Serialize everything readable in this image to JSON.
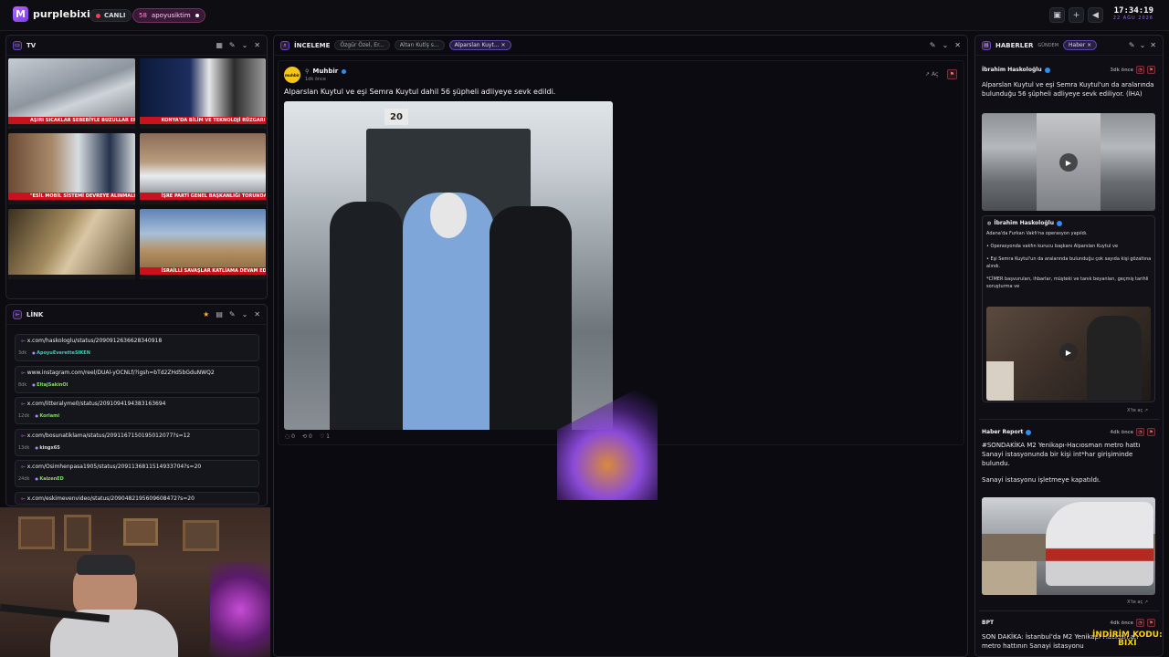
{
  "app": {
    "name": "purplebixi"
  },
  "topbar": {
    "live_label": "CANLI",
    "channel_count": "58",
    "channel_name": "apoyusiktim",
    "time": "17:34:19",
    "date": "22 AĞU 2026"
  },
  "tv_panel": {
    "title": "TV",
    "captions": [
      "AŞIRI SICAKLAR SEBEBİYLE BUZULLAR ERİYOR",
      "KONYA'DA BİLİM VE TEKNOLOJİ RÜZGARI",
      "\"ESİL MOBİL SİSTEMİ DEVREYE ALINMALI\"",
      "İŞRE PARTİ GENEL BAŞKANLIĞI TORUNDA",
      "",
      "İSRAİLLİ SAVAŞLAR KATLİAMA DEVAM EDİYOR"
    ]
  },
  "link_panel": {
    "title": "LİNK",
    "items": [
      {
        "url": "x.com/haskologlu/status/2090912636628340918",
        "age": "3dk",
        "user": "ApoyuEverettеSIKEN",
        "color": "#38d0b8"
      },
      {
        "url": "www.instagram.com/reel/DUAl-yOCNLf/?igsh=bTd2ZHd5bGduNWQ2",
        "age": "8dk",
        "user": "EltajSakinOl",
        "color": "#7ee05b"
      },
      {
        "url": "x.com/litteralyme0/status/2091094194383163694",
        "age": "12dk",
        "user": "Korlami",
        "color": "#7ee05b"
      },
      {
        "url": "x.com/bosunatiklama/status/2091167150195012077?s=12",
        "age": "13dk",
        "user": "kingx65",
        "color": "#d8d8d8"
      },
      {
        "url": "x.com/Osimhenpasa1905/status/2091136811514933704?s=20",
        "age": "24dk",
        "user": "KaizenED",
        "color": "#7ee05b"
      },
      {
        "url": "x.com/eskimevenvideo/status/2090482195609608472?s=20",
        "age": "",
        "user": "",
        "color": "#d8d8d8"
      }
    ]
  },
  "review_panel": {
    "title": "İNCELEME",
    "tabs": [
      "Özgür Özel, Er...",
      "Altan Kutlş s...",
      "Alparslan Kuyt..."
    ],
    "post": {
      "author": "Muhbir",
      "time": "1dk önce",
      "open_label": "Aç",
      "text": "Alparslan Kuytul ve eşi Semra Kuytul dahil 56 şüpheli adliyeye sevk edildi.",
      "comments": "0",
      "reposts": "0",
      "likes": "1"
    }
  },
  "news_panel": {
    "title": "HABERLER",
    "tabs": [
      "GÜNDEM",
      "Haber"
    ],
    "items": [
      {
        "author": "İbrahim Haskoloğlu",
        "ago": "3dk önce",
        "text": "Alparslan Kuytul ve eşi Semra Kuytul'un da aralarında bulunduğu 56 şüpheli adliyeye sevk ediliyor. (İHA)",
        "quote_author": "İbrahim Haskoloğlu",
        "quote_lines": [
          "Adana'da Furkan Vakfı'na operasyon yapıldı.",
          "• Operasyonda vakfın kurucu başkanı Alparslan Kuytul ve",
          "• Eşi Semra Kuytul'un da aralarında bulunduğu çok sayıda kişi gözaltına alındı.",
          "*CİMER başvuruları, ihbarlar, müşteki ve tanık beyanları, geçmiş tarihli soruşturma ve"
        ],
        "open": "X'te aç"
      },
      {
        "author": "Haber Report",
        "ago": "4dk önce",
        "text": "#SONDAKİKA M2 Yenikapı-Hacıosman metro hattı Sanayi istasyonunda bir kişi int*har girişiminde bulundu.",
        "text2": "Sanayi istasyonu işletmeye kapatıldı.",
        "open": "X'te aç"
      },
      {
        "author": "BPT",
        "ago": "4dk önce",
        "text": "SON DAKİKA: İstanbul'da M2 Yenikapı-Hacıosman metro hattının Sanayi istasyonu"
      }
    ]
  },
  "overlay": {
    "promo_line1": "İNDİRİM KODU:",
    "promo_line2": "BIXI"
  }
}
